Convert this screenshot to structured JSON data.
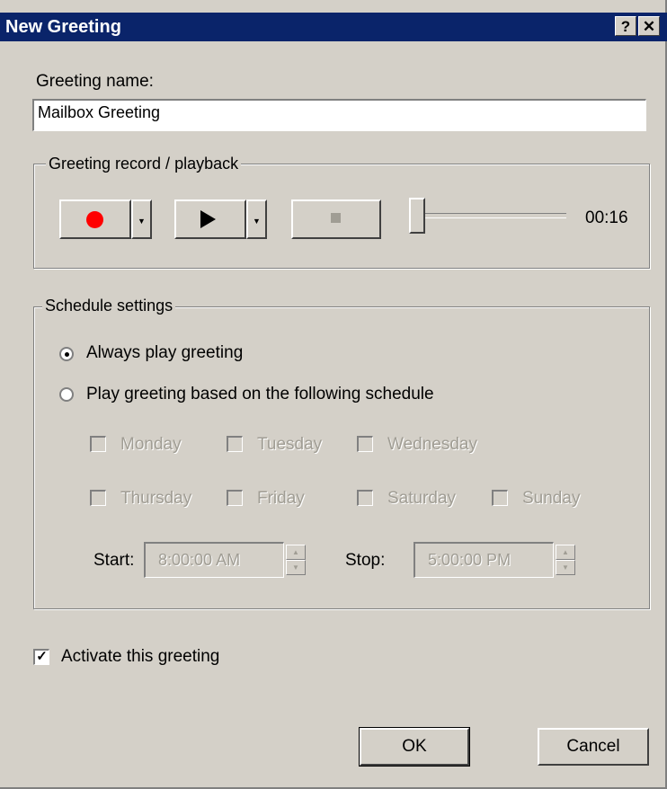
{
  "window": {
    "title": "New Greeting",
    "help_button": "?",
    "close_button": "✕"
  },
  "greeting_name": {
    "label": "Greeting name:",
    "value": "Mailbox Greeting"
  },
  "record_group": {
    "title": "Greeting record / playback",
    "time": "00:16",
    "record_color": "#ff0000"
  },
  "schedule_group": {
    "title": "Schedule settings",
    "always_label": "Always play greeting",
    "schedule_label": "Play greeting based on the following schedule",
    "days": {
      "monday": "Monday",
      "tuesday": "Tuesday",
      "wednesday": "Wednesday",
      "thursday": "Thursday",
      "friday": "Friday",
      "saturday": "Saturday",
      "sunday": "Sunday"
    },
    "start_label": "Start:",
    "start_value": "8:00:00 AM",
    "stop_label": "Stop:",
    "stop_value": "5:00:00 PM"
  },
  "activate": {
    "label": "Activate this greeting",
    "checked": true
  },
  "buttons": {
    "ok": "OK",
    "cancel": "Cancel"
  }
}
